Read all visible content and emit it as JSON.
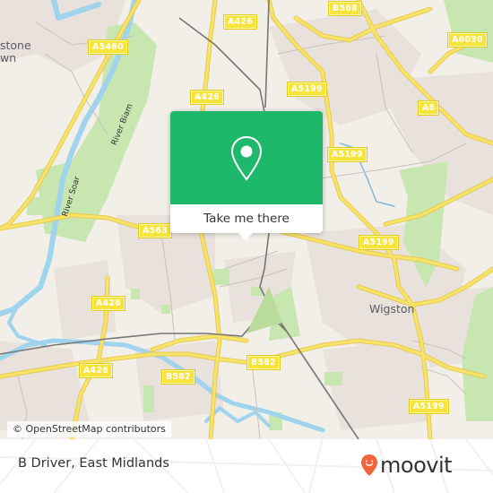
{
  "map": {
    "colors": {
      "land": "#f2efe9",
      "urban": "#e8e1dc",
      "park": "#c8e6b0",
      "water": "#9fd3ee",
      "major_road": "#f7e36a",
      "road_casing": "#e6c84a",
      "minor_road": "#c8c2bb",
      "railway": "#777777",
      "popup_green": "#1eb86b",
      "brand_orange": "#f2643b"
    },
    "road_labels": [
      "A426",
      "B568",
      "A6030",
      "A5460",
      "A426",
      "A5199",
      "A6",
      "A5199",
      "A563",
      "A5199",
      "A426",
      "A426",
      "B582",
      "B582",
      "A5199"
    ],
    "place_labels": [
      "stone",
      "wn",
      "Wigston"
    ],
    "water_labels": [
      "River Biam",
      "River Soar"
    ]
  },
  "popup": {
    "icon": "map-pin-icon",
    "button_label": "Take me there"
  },
  "attribution": {
    "text": "© OpenStreetMap contributors"
  },
  "footer": {
    "title": "B Driver, East Midlands",
    "brand_icon": "moovit-smile-pin-icon",
    "brand_name": "moovit"
  }
}
